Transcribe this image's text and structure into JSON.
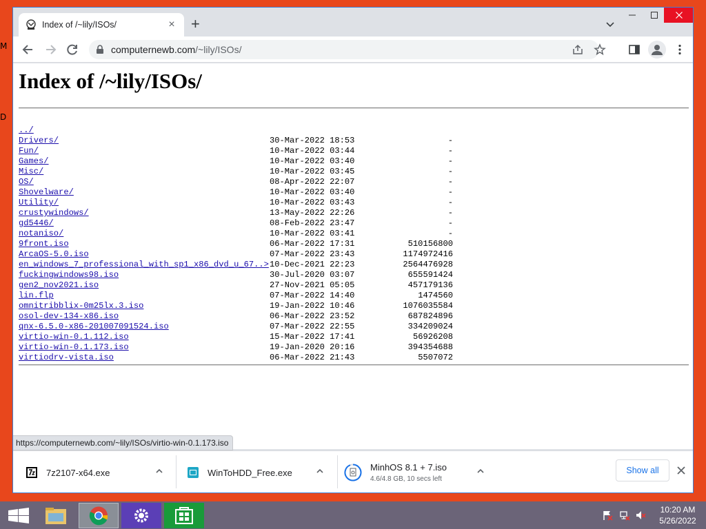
{
  "desktop": {
    "labels": [
      "M",
      "D"
    ]
  },
  "browser": {
    "tab_title": "Index of /~lily/ISOs/",
    "url_host": "computernewb.com",
    "url_path": "/~lily/ISOs/",
    "accent": "#1a0dab"
  },
  "page": {
    "heading": "Index of /~lily/ISOs/",
    "entries": [
      {
        "name": "../",
        "date": "",
        "size": ""
      },
      {
        "name": "Drivers/",
        "date": "30-Mar-2022 18:53",
        "size": "-"
      },
      {
        "name": "Fun/",
        "date": "10-Mar-2022 03:44",
        "size": "-"
      },
      {
        "name": "Games/",
        "date": "10-Mar-2022 03:40",
        "size": "-"
      },
      {
        "name": "Misc/",
        "date": "10-Mar-2022 03:45",
        "size": "-"
      },
      {
        "name": "OS/",
        "date": "08-Apr-2022 22:07",
        "size": "-"
      },
      {
        "name": "Shovelware/",
        "date": "10-Mar-2022 03:40",
        "size": "-"
      },
      {
        "name": "Utility/",
        "date": "10-Mar-2022 03:43",
        "size": "-"
      },
      {
        "name": "crustywindows/",
        "date": "13-May-2022 22:26",
        "size": "-"
      },
      {
        "name": "gd5446/",
        "date": "08-Feb-2022 23:47",
        "size": "-"
      },
      {
        "name": "notaniso/",
        "date": "10-Mar-2022 03:41",
        "size": "-"
      },
      {
        "name": "9front.iso",
        "date": "06-Mar-2022 17:31",
        "size": "510156800"
      },
      {
        "name": "ArcaOS-5.0.iso",
        "date": "07-Mar-2022 23:43",
        "size": "1174972416"
      },
      {
        "name": "en_windows_7_professional_with_sp1_x86_dvd_u_67..>",
        "date": "10-Dec-2021 22:23",
        "size": "2564476928"
      },
      {
        "name": "fuckingwindows98.iso",
        "date": "30-Jul-2020 03:07",
        "size": "655591424"
      },
      {
        "name": "gen2_nov2021.iso",
        "date": "27-Nov-2021 05:05",
        "size": "457179136"
      },
      {
        "name": "lin.flp",
        "date": "07-Mar-2022 14:40",
        "size": "1474560"
      },
      {
        "name": "omnitribblix-0m25lx.3.iso",
        "date": "19-Jan-2022 10:46",
        "size": "1076035584"
      },
      {
        "name": "osol-dev-134-x86.iso",
        "date": "06-Mar-2022 23:52",
        "size": "687824896"
      },
      {
        "name": "qnx-6.5.0-x86-201007091524.iso",
        "date": "07-Mar-2022 22:55",
        "size": "334209024"
      },
      {
        "name": "virtio-win-0.1.112.iso",
        "date": "15-Mar-2022 17:41",
        "size": "56926208"
      },
      {
        "name": "virtio-win-0.1.173.iso",
        "date": "19-Jan-2020 20:16",
        "size": "394354688"
      },
      {
        "name": "virtiodrv-vista.iso",
        "date": "06-Mar-2022 21:43",
        "size": "5507072"
      }
    ]
  },
  "status_bar": {
    "hover_url": "https://computernewb.com/~lily/ISOs/virtio-win-0.1.173.iso"
  },
  "downloads": {
    "items": [
      {
        "name": "7z2107-x64.exe",
        "sub": ""
      },
      {
        "name": "WinToHDD_Free.exe",
        "sub": ""
      },
      {
        "name": "MinhOS 8.1 + 7.iso",
        "sub": "4.6/4.8 GB, 10 secs left"
      }
    ],
    "show_all_label": "Show all"
  },
  "taskbar": {
    "apps": [
      "start-icon",
      "file-explorer-icon",
      "chrome-icon",
      "settings-icon",
      "store-icon"
    ],
    "time": "10:20 AM",
    "date": "5/26/2022"
  }
}
